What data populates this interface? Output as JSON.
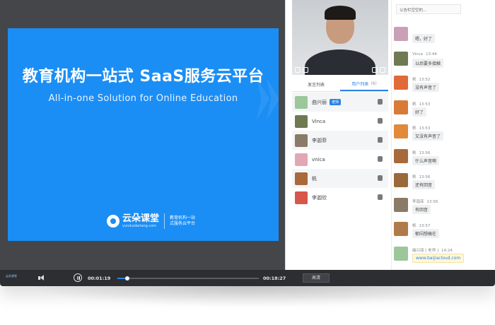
{
  "slide": {
    "title": "教育机构一站式  SaaS服务云平台",
    "subtitle": "All-in-one Solution for Online Education",
    "logo_name": "云朵课堂",
    "logo_domain": "yunduoketang.com",
    "logo_tagline_1": "教育机构一站",
    "logo_tagline_2": "式服务云平台"
  },
  "panel": {
    "tabs": [
      {
        "label": "发言列表",
        "count": ""
      },
      {
        "label": "用户列表",
        "count": "(6)"
      }
    ],
    "users": [
      {
        "name": "曲兴丽",
        "badge": "老师",
        "avatar_color": "#9bc79a",
        "os": "windows-icon"
      },
      {
        "name": "Vinca",
        "badge": "",
        "avatar_color": "#6f7a53",
        "os": "apple-icon"
      },
      {
        "name": "李迦菲",
        "badge": "",
        "avatar_color": "#8a7a68",
        "os": "android-icon"
      },
      {
        "name": "vnica",
        "badge": "",
        "avatar_color": "#e2a7b5",
        "os": "windows-icon"
      },
      {
        "name": "帆",
        "badge": "",
        "avatar_color": "#a86a3a",
        "os": "android-icon"
      },
      {
        "name": "李迦欣",
        "badge": "",
        "avatar_color": "#d8564a",
        "os": "android-icon"
      }
    ]
  },
  "chat": {
    "top_text": "公告栏空空的...",
    "messages": [
      {
        "name": "",
        "time": "",
        "text": "嗯，好了",
        "avatar_color": "#c9a0b6",
        "link": false
      },
      {
        "name": "Vinca",
        "time": "13:44",
        "text": "以后要多接触",
        "avatar_color": "#6f7a53",
        "link": false
      },
      {
        "name": "帆",
        "time": "13:52",
        "text": "没有声音了",
        "avatar_color": "#e06a3a",
        "link": false
      },
      {
        "name": "帆",
        "time": "13:53",
        "text": "好了",
        "avatar_color": "#d87a3a",
        "link": false
      },
      {
        "name": "帆",
        "time": "13:53",
        "text": "又没有声音了",
        "avatar_color": "#e08a3a",
        "link": false
      },
      {
        "name": "帆",
        "time": "13:56",
        "text": "什么声音啊",
        "avatar_color": "#a86a3a",
        "link": false
      },
      {
        "name": "帆",
        "time": "13:56",
        "text": "还有回音",
        "avatar_color": "#9a6a3a",
        "link": false
      },
      {
        "name": "李迦菲",
        "time": "13:56",
        "text": "有回音",
        "avatar_color": "#8a7a68",
        "link": false
      },
      {
        "name": "帆",
        "time": "13:57",
        "text": "郁闷想搞在",
        "avatar_color": "#b07a4a",
        "link": false
      },
      {
        "name": "曲兴丽 [ 老师 ]",
        "time": "14:24",
        "text": "www.baijiacloud.com",
        "avatar_color": "#9bc79a",
        "link": true
      }
    ]
  },
  "controls": {
    "logo_text": "云朵课堂",
    "current_time": "00:01:19",
    "total_time": "00:18:27",
    "progress": 0.07,
    "quality_label": "高清"
  }
}
